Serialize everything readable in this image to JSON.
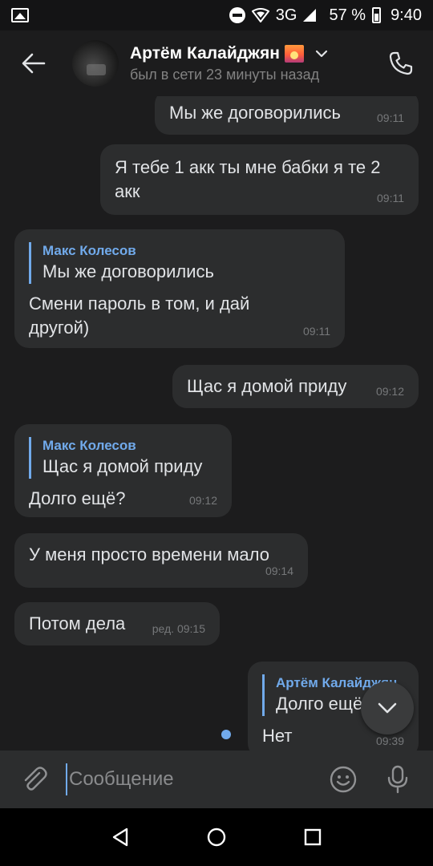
{
  "status_bar": {
    "network": "3G",
    "battery": "57 %",
    "time": "9:40"
  },
  "header": {
    "contact_name": "Артём Калайджян",
    "status": "был в сети 23 минуты назад"
  },
  "messages": [
    {
      "dir": "out",
      "text": "Мы же договорились",
      "time": "09:11"
    },
    {
      "dir": "out",
      "text": "Я тебе 1 акк ты мне бабки я те 2 акк",
      "time": "09:11"
    },
    {
      "dir": "in",
      "reply_name": "Макс Колесов",
      "reply_text": "Мы же договорились",
      "text": "Смени пароль в том, и дай другой)",
      "time": "09:11"
    },
    {
      "dir": "out",
      "text": "Щас я домой приду",
      "time": "09:12"
    },
    {
      "dir": "in",
      "reply_name": "Макс Колесов",
      "reply_text": "Щас я домой приду",
      "text": "Долго ещё?",
      "time": "09:12"
    },
    {
      "dir": "in",
      "text": "У меня просто времени мало",
      "time": "09:14"
    },
    {
      "dir": "in",
      "text": "Потом дела",
      "time": "ред. 09:15"
    },
    {
      "dir": "out",
      "reply_name": "Артём Калайджян",
      "reply_text": "Долго ещё?",
      "text": "Нет",
      "time": "09:39"
    }
  ],
  "composer": {
    "placeholder": "Сообщение"
  },
  "icons": [
    "image-icon",
    "dnd-icon",
    "vpn-icon",
    "signal-icon",
    "battery-icon",
    "back-arrow-icon",
    "chevron-down-icon",
    "phone-icon",
    "chevron-down-icon",
    "paperclip-icon",
    "emoji-icon",
    "mic-icon",
    "nav-back-icon",
    "nav-home-icon",
    "nav-recents-icon"
  ],
  "colors": {
    "background": "#1c1c1d",
    "bubble": "#2c2d2e",
    "accent": "#71aaeb",
    "text": "#e1e3e6",
    "muted": "#828282"
  }
}
